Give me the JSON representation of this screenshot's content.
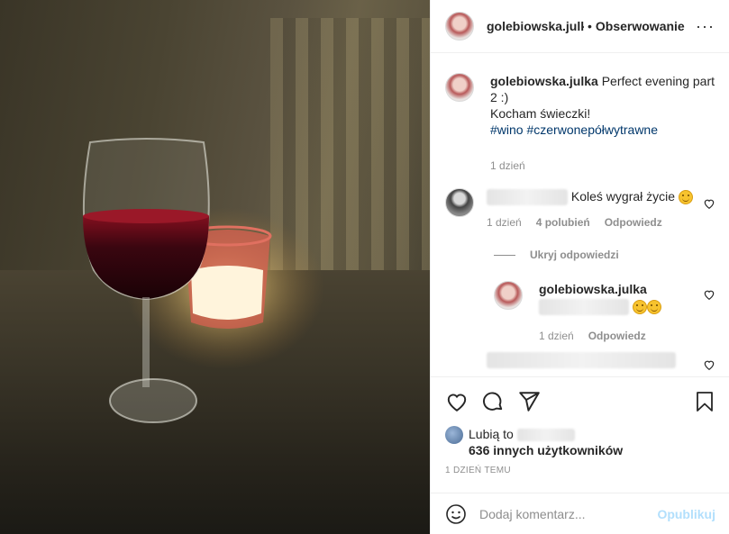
{
  "header": {
    "username": "golebiowska.julka",
    "dot": "•",
    "follow_label": "Obserwowanie",
    "more_label": "···"
  },
  "caption": {
    "username": "golebiowska.julka",
    "text": "Perfect evening part 2 :)",
    "line2": "Kocham świeczki!",
    "hashtags": [
      "#wino",
      "#czerwonepółwytrawne"
    ],
    "time": "1 dzień"
  },
  "comments": [
    {
      "text": "Koleś wygrał życie",
      "time": "1 dzień",
      "likes": "4 polubień",
      "reply": "Odpowiedz",
      "hide_replies": "Ukryj odpowiedzi"
    }
  ],
  "reply": {
    "username": "golebiowska.julka",
    "time": "1 dzień",
    "reply": "Odpowiedz"
  },
  "likes": {
    "prefix": "Lubią to",
    "others": "636 innych użytkowników"
  },
  "post_time": "1 DZIEŃ TEMU",
  "add_comment": {
    "placeholder": "Dodaj komentarz...",
    "publish": "Opublikuj"
  },
  "icons": {
    "like": "heart-icon",
    "comment": "comment-icon",
    "share": "paper-plane-icon",
    "save": "bookmark-icon",
    "emoji": "smiley-icon"
  }
}
